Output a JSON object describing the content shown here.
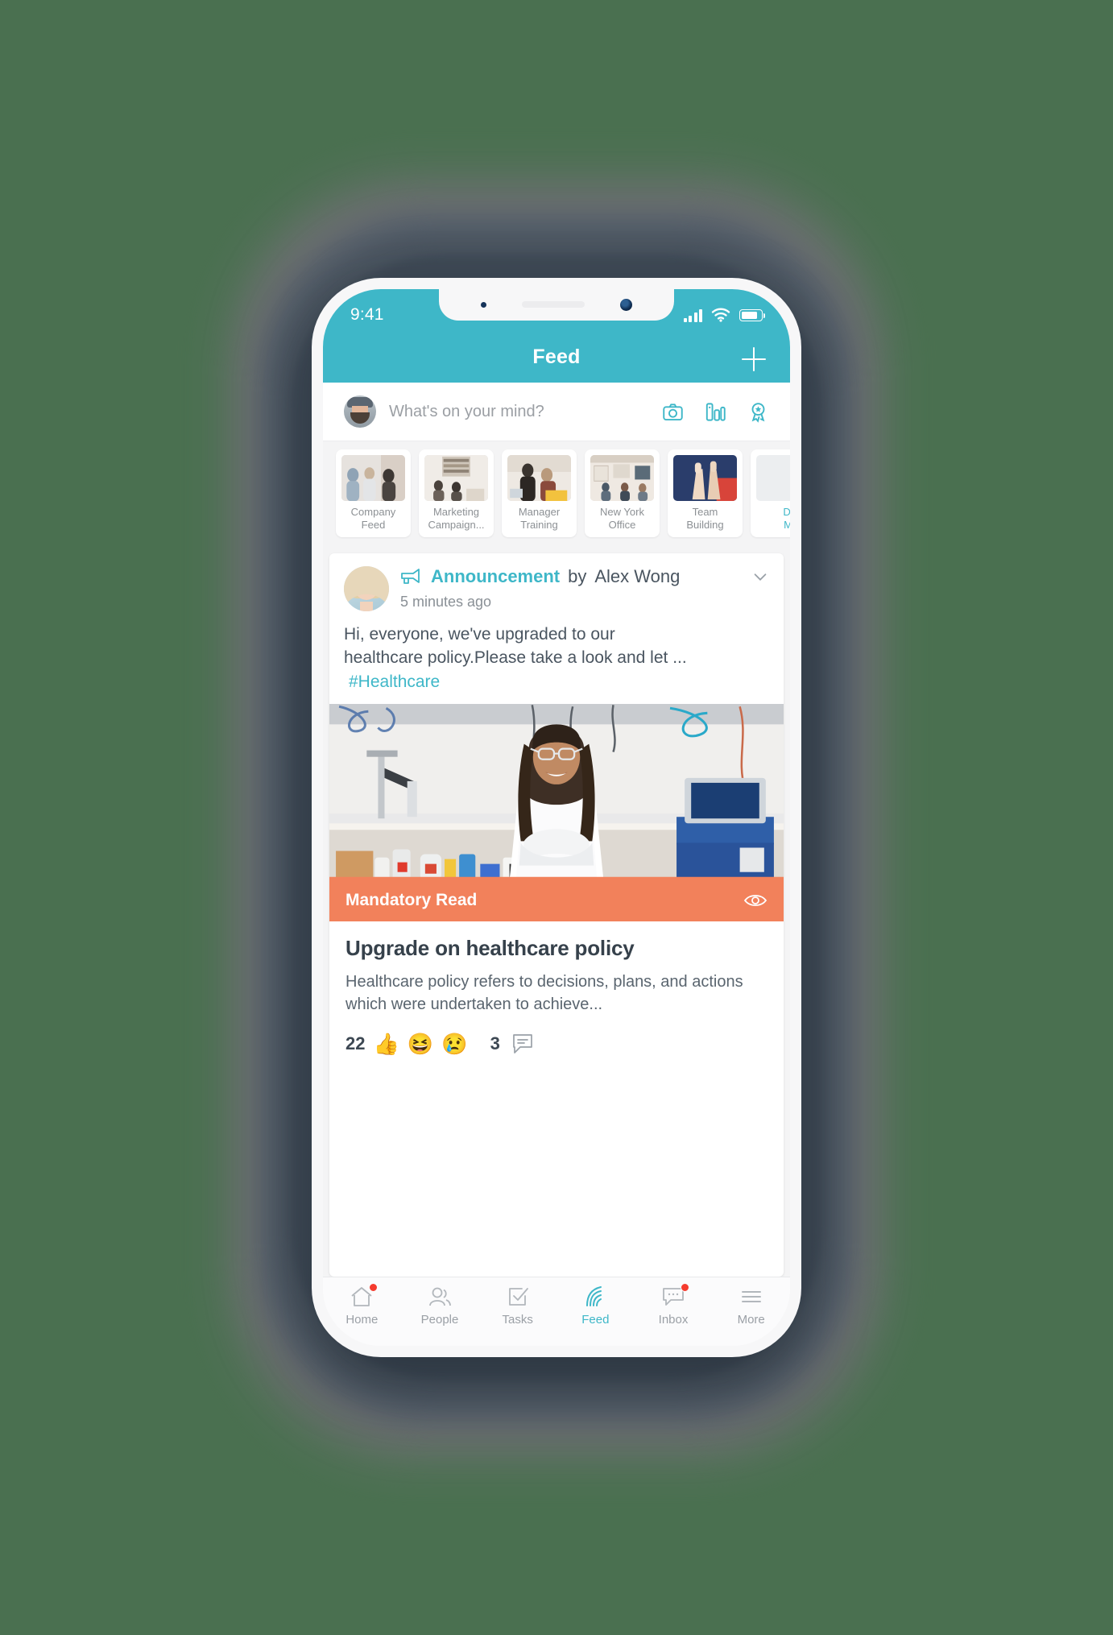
{
  "status_bar": {
    "time": "9:41",
    "icons": [
      "signal-bars-icon",
      "wifi-icon",
      "battery-icon"
    ]
  },
  "navbar": {
    "title": "Feed",
    "add_icon": "plus-icon"
  },
  "composer": {
    "avatar": "user-avatar",
    "placeholder": "What's on your mind?",
    "actions": [
      {
        "name": "camera-icon",
        "label": "Camera"
      },
      {
        "name": "poll-icon",
        "label": "Poll"
      },
      {
        "name": "badge-icon",
        "label": "Recognition"
      }
    ]
  },
  "channels": [
    {
      "label_line1": "Company",
      "label_line2": "Feed"
    },
    {
      "label_line1": "Marketing",
      "label_line2": "Campaign..."
    },
    {
      "label_line1": "Manager",
      "label_line2": "Training"
    },
    {
      "label_line1": "New York",
      "label_line2": "Office"
    },
    {
      "label_line1": "Team",
      "label_line2": "Building"
    },
    {
      "label_line1": "Di",
      "label_line2": "M"
    }
  ],
  "post": {
    "type_icon": "megaphone-icon",
    "type_label": "Announcement",
    "author_prefix": "by",
    "author": "Alex Wong",
    "menu_icon": "chevron-down-icon",
    "timestamp": "5 minutes ago",
    "body_line1": "Hi, everyone, we've upgraded to our",
    "body_line2": "healthcare policy.Please take a look and let ...",
    "hashtag": "#Healthcare",
    "hero_image": "female-scientist-in-laboratory",
    "banner": {
      "label": "Mandatory Read",
      "icon": "eye-icon",
      "color": "#F2815B"
    },
    "article": {
      "title": "Upgrade on healthcare policy",
      "excerpt": "Healthcare policy refers to decisions, plans, and actions which were undertaken to achieve..."
    },
    "reactions": {
      "count": "22",
      "emojis": [
        "👍",
        "😆",
        "😢"
      ],
      "comment_count": "3",
      "comment_icon": "comment-bubble-icon"
    }
  },
  "tabbar": [
    {
      "label": "Home",
      "icon": "home-icon",
      "active": false,
      "badge": true
    },
    {
      "label": "People",
      "icon": "people-icon",
      "active": false,
      "badge": false
    },
    {
      "label": "Tasks",
      "icon": "tasks-icon",
      "active": false,
      "badge": false
    },
    {
      "label": "Feed",
      "icon": "feed-icon",
      "active": true,
      "badge": false
    },
    {
      "label": "Inbox",
      "icon": "inbox-icon",
      "active": false,
      "badge": true
    },
    {
      "label": "More",
      "icon": "more-icon",
      "active": false,
      "badge": false
    }
  ],
  "colors": {
    "accent": "#3EB7C8",
    "mandatory": "#F2815B",
    "background": "#4A7050",
    "badge": "#F53B2E"
  }
}
